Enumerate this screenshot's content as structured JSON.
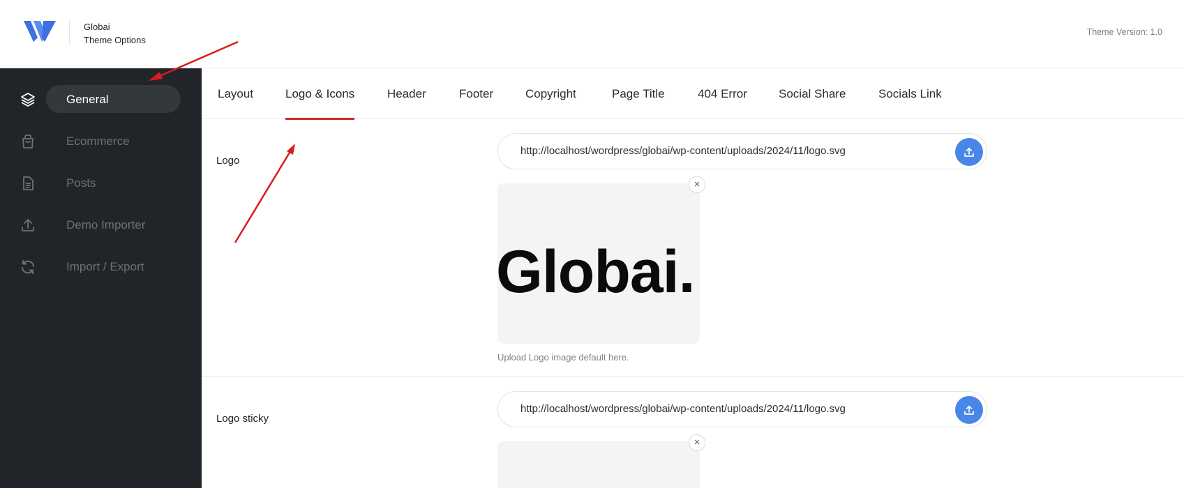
{
  "header": {
    "brand_name": "Globai",
    "brand_subtitle": "Theme Options",
    "theme_version": "Theme Version: 1.0"
  },
  "sidebar": {
    "items": [
      {
        "label": "General",
        "icon": "layers-icon",
        "active": true
      },
      {
        "label": "Ecommerce",
        "icon": "shopping-bag-icon",
        "active": false
      },
      {
        "label": "Posts",
        "icon": "document-icon",
        "active": false
      },
      {
        "label": "Demo Importer",
        "icon": "upload-icon",
        "active": false
      },
      {
        "label": "Import / Export",
        "icon": "sync-icon",
        "active": false
      }
    ]
  },
  "tabs": [
    {
      "label": "Layout",
      "active": false
    },
    {
      "label": "Logo & Icons",
      "active": true
    },
    {
      "label": "Header",
      "active": false
    },
    {
      "label": "Footer",
      "active": false
    },
    {
      "label": "Copyright",
      "active": false
    },
    {
      "label": "Page Title",
      "active": false
    },
    {
      "label": "404 Error",
      "active": false
    },
    {
      "label": "Social Share",
      "active": false
    },
    {
      "label": "Socials Link",
      "active": false
    }
  ],
  "fields": {
    "logo": {
      "label": "Logo",
      "url": "http://localhost/wordpress/globai/wp-content/uploads/2024/11/logo.svg",
      "preview_text": "Globai.",
      "help": "Upload Logo image default here."
    },
    "logo_sticky": {
      "label": "Logo sticky",
      "url": "http://localhost/wordpress/globai/wp-content/uploads/2024/11/logo.svg"
    }
  },
  "colors": {
    "sidebar_bg": "#212529",
    "accent_tab_underline": "#d42a2a",
    "upload_button": "#4a86e8",
    "annotation_arrow": "#d91c1c"
  },
  "icons": {
    "remove": "×"
  }
}
